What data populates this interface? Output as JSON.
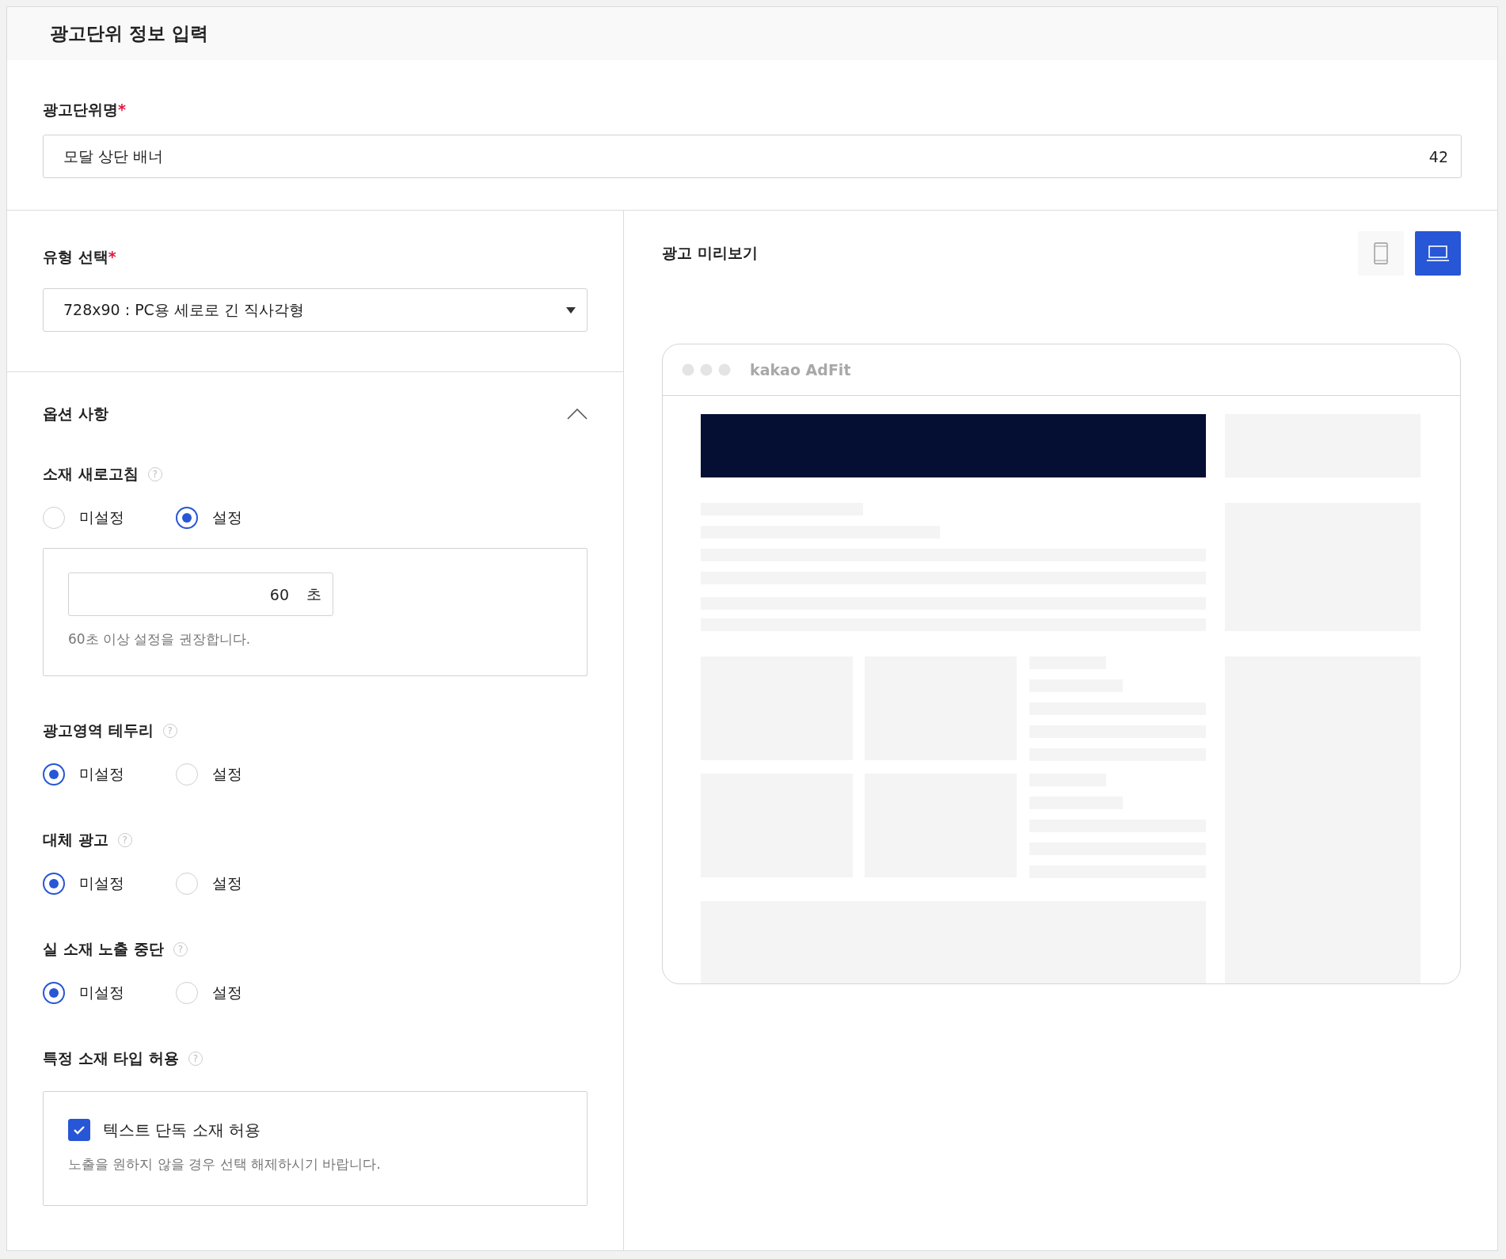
{
  "header": {
    "title": "광고단위 정보 입력"
  },
  "name_field": {
    "label": "광고단위명",
    "required_mark": "*",
    "value": "모달 상단 배너",
    "counter": "42"
  },
  "type_select": {
    "label": "유형 선택",
    "required_mark": "*",
    "value": "728x90 : PC용 세로로 긴 직사각형"
  },
  "options": {
    "title": "옵션 사항",
    "expanded": true,
    "groups": [
      {
        "kind": "radio",
        "label": "소재 새로고침",
        "help": "?",
        "choices": [
          {
            "label": "미설정",
            "selected": false
          },
          {
            "label": "설정",
            "selected": true
          }
        ],
        "detail": {
          "value": "60",
          "unit": "초",
          "hint": "60초 이상 설정을 권장합니다."
        }
      },
      {
        "kind": "radio",
        "label": "광고영역 테두리",
        "help": "?",
        "choices": [
          {
            "label": "미설정",
            "selected": true
          },
          {
            "label": "설정",
            "selected": false
          }
        ]
      },
      {
        "kind": "radio",
        "label": "대체 광고",
        "help": "?",
        "choices": [
          {
            "label": "미설정",
            "selected": true
          },
          {
            "label": "설정",
            "selected": false
          }
        ]
      },
      {
        "kind": "radio",
        "label": "실 소재 노출 중단",
        "help": "?",
        "choices": [
          {
            "label": "미설정",
            "selected": true
          },
          {
            "label": "설정",
            "selected": false
          }
        ]
      },
      {
        "kind": "checkbox",
        "label": "특정 소재 타입 허용",
        "help": "?",
        "checkbox": {
          "label": "텍스트 단독 소재 허용",
          "checked": true
        },
        "hint": "노출을 원하지 않을 경우 선택 해제하시기 바랍니다."
      }
    ]
  },
  "preview": {
    "title": "광고 미리보기",
    "devices": [
      {
        "kind": "mobile",
        "selected": false
      },
      {
        "kind": "pc",
        "selected": true
      }
    ],
    "browser_brand": "kakao AdFit"
  }
}
